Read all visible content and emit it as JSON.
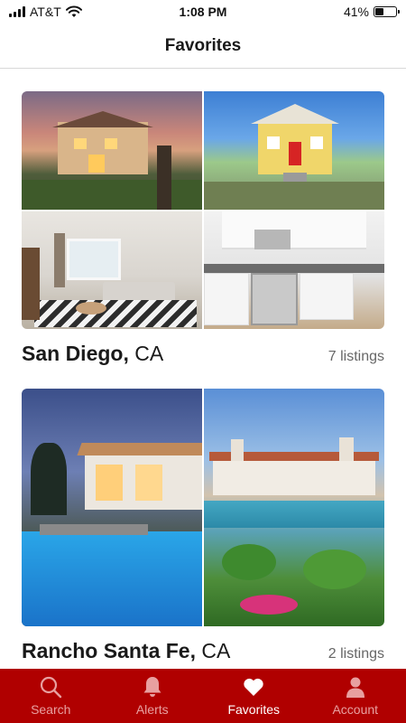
{
  "status_bar": {
    "carrier": "AT&T",
    "time": "1:08 PM",
    "battery_percent_label": "41%",
    "battery_level": 0.41,
    "icons": [
      "signal-icon",
      "wifi-icon",
      "battery-icon"
    ]
  },
  "header": {
    "title": "Favorites"
  },
  "favorites": [
    {
      "city": "San Diego,",
      "state": "CA",
      "listings": "7 listings",
      "photos": [
        "dusk-house-exterior",
        "yellow-house-exterior",
        "living-room",
        "kitchen"
      ]
    },
    {
      "city": "Rancho Santa Fe,",
      "state": "CA",
      "listings": "2 listings",
      "photos": [
        "pool-night",
        "pool-villa"
      ]
    }
  ],
  "tabbar": {
    "tabs": [
      {
        "label": "Search",
        "icon": "search-icon",
        "active": false
      },
      {
        "label": "Alerts",
        "icon": "bell-icon",
        "active": false
      },
      {
        "label": "Favorites",
        "icon": "heart-icon",
        "active": true
      },
      {
        "label": "Account",
        "icon": "person-icon",
        "active": false
      }
    ],
    "colors": {
      "background": "#b00000",
      "active": "#ffffff",
      "inactive": "#e8a0a0"
    }
  }
}
